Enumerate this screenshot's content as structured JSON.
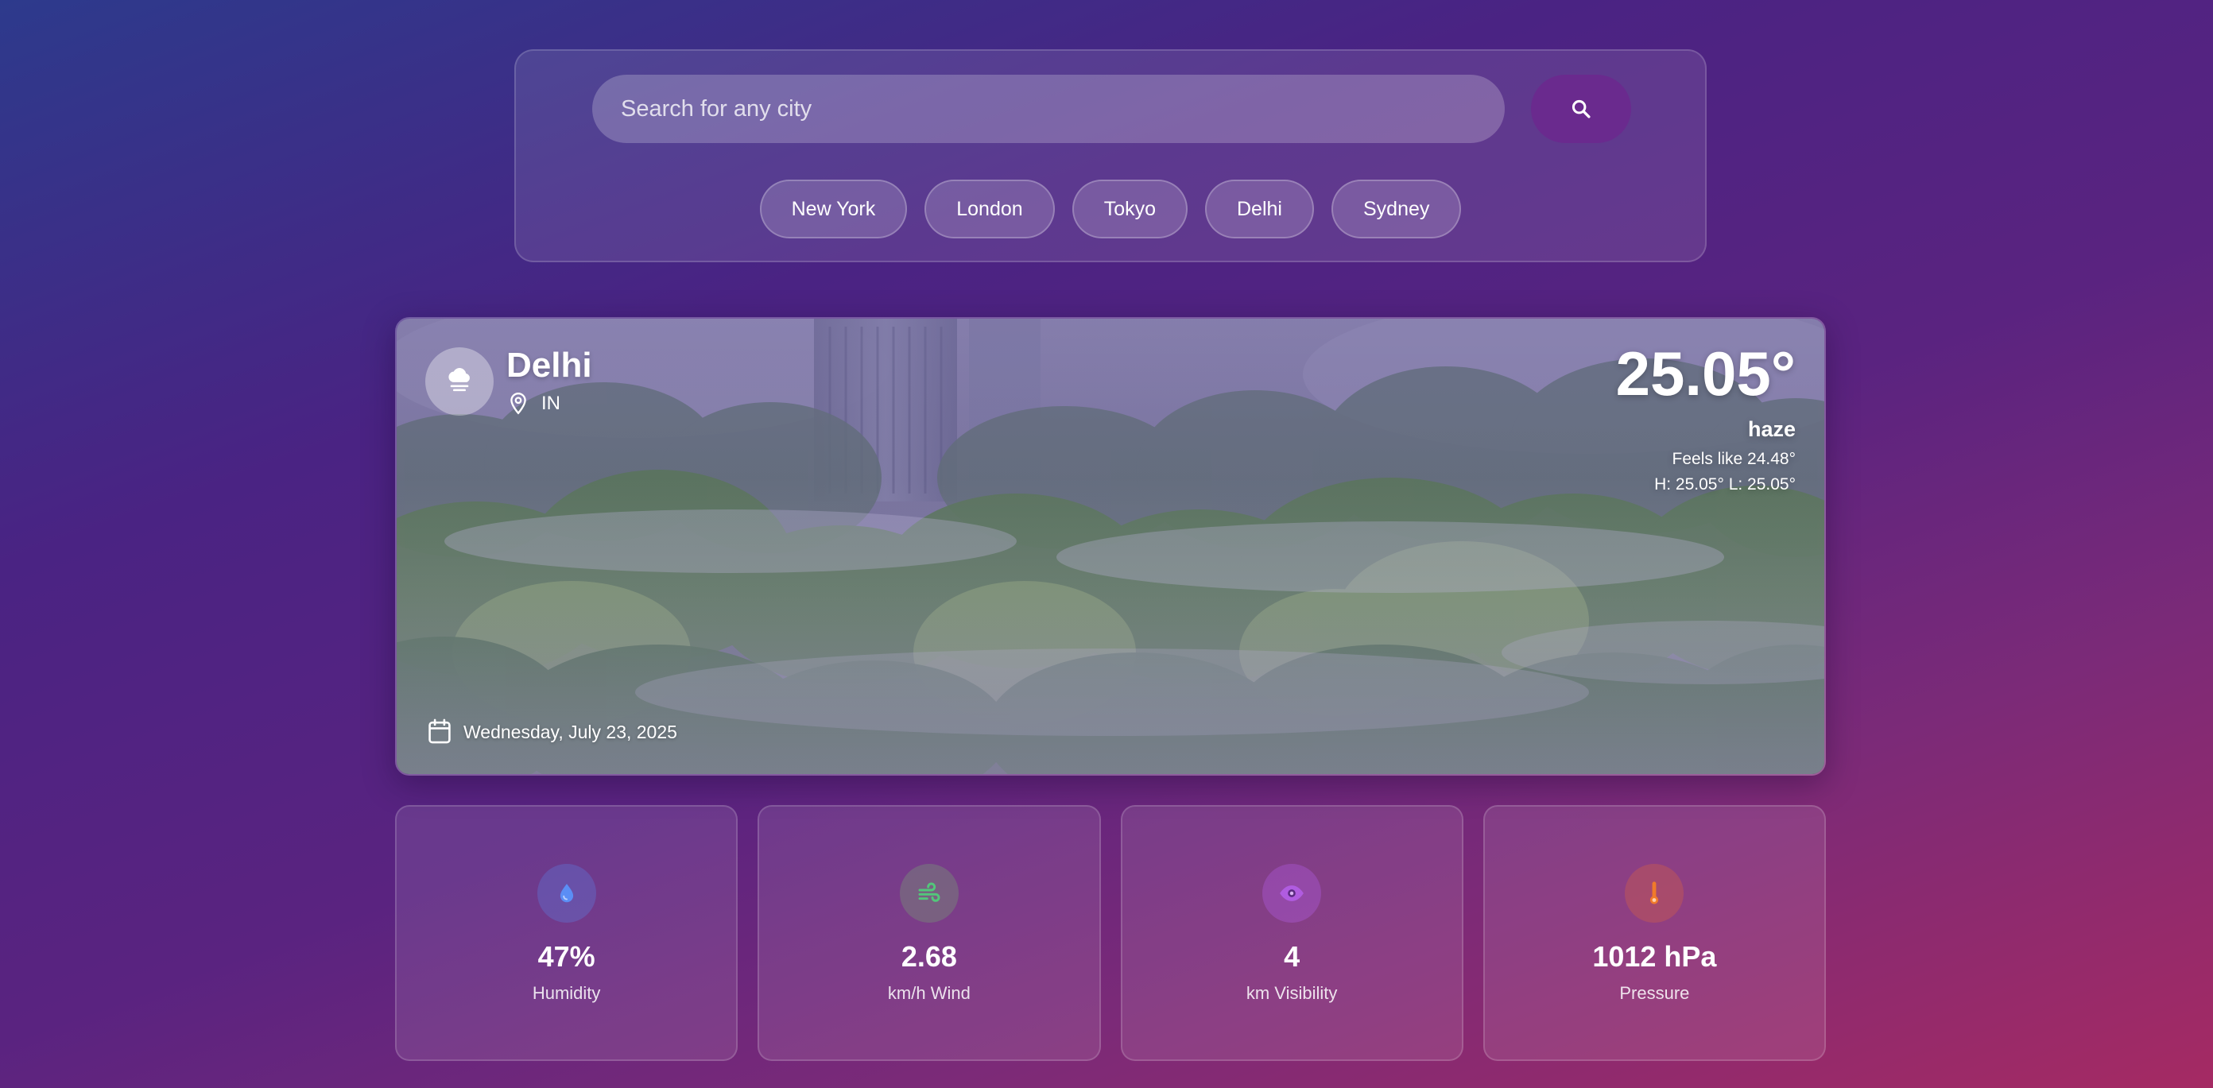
{
  "search": {
    "placeholder": "Search for any city",
    "button_icon": "search-icon"
  },
  "quick_cities": [
    "New York",
    "London",
    "Tokyo",
    "Delhi",
    "Sydney"
  ],
  "current": {
    "city": "Delhi",
    "country": "IN",
    "weather_icon": "haze-cloud-icon",
    "temperature": "25.05°",
    "condition": "haze",
    "feels_like": "Feels like 24.48°",
    "high_low": "H: 25.05° L: 25.05°",
    "date": "Wednesday, July 23, 2025"
  },
  "stats": [
    {
      "icon": "droplet-icon",
      "value": "47%",
      "label": "Humidity",
      "color": "#5b8ef5"
    },
    {
      "icon": "wind-icon",
      "value": "2.68",
      "label": "km/h Wind",
      "color": "#52c77a"
    },
    {
      "icon": "eye-icon",
      "value": "4",
      "label": "km Visibility",
      "color": "#b05ce0"
    },
    {
      "icon": "thermometer-icon",
      "value": "1012 hPa",
      "label": "Pressure",
      "color": "#f07a2a"
    }
  ],
  "colors": {
    "background_start": "#2d3a8c",
    "background_mid": "#4a2383",
    "background_end": "#a52a63",
    "search_button": "#6a2a8e"
  }
}
